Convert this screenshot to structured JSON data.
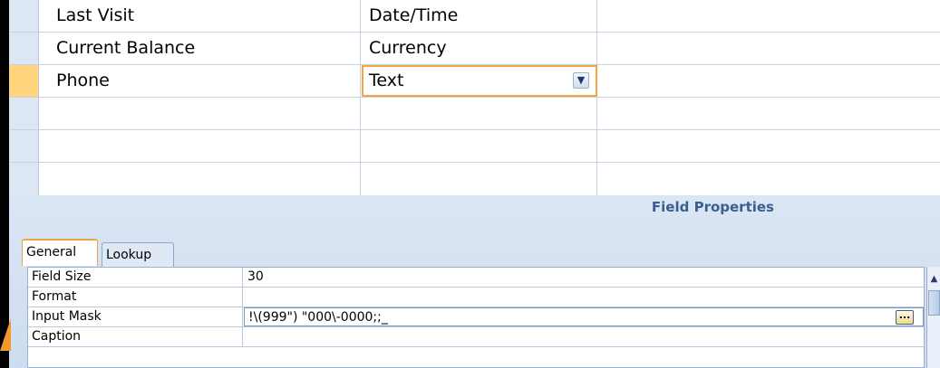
{
  "grid": {
    "rows": [
      {
        "name": "Last Visit",
        "type": "Date/Time",
        "current": false
      },
      {
        "name": "Current Balance",
        "type": "Currency",
        "current": false
      },
      {
        "name": "Phone",
        "type": "Text",
        "current": true
      },
      {
        "name": "",
        "type": "",
        "current": false
      },
      {
        "name": "",
        "type": "",
        "current": false
      },
      {
        "name": "",
        "type": "",
        "current": false
      }
    ],
    "dropdown_icon": "chevron-down-icon"
  },
  "field_properties": {
    "title": "Field Properties",
    "tabs": [
      "General",
      "Lookup"
    ],
    "active_tab": "General",
    "properties": [
      {
        "label": "Field Size",
        "value": "30"
      },
      {
        "label": "Format",
        "value": ""
      },
      {
        "label": "Input Mask",
        "value": "!\\(999\") \"000\\-0000;;_"
      },
      {
        "label": "Caption",
        "value": ""
      }
    ],
    "build_button_label": "..."
  },
  "colors": {
    "selection_accent": "#f2a541",
    "row_selector_current": "#ffd47d",
    "pane_background": "#dbe6f4",
    "title_color": "#3a5f8f"
  }
}
